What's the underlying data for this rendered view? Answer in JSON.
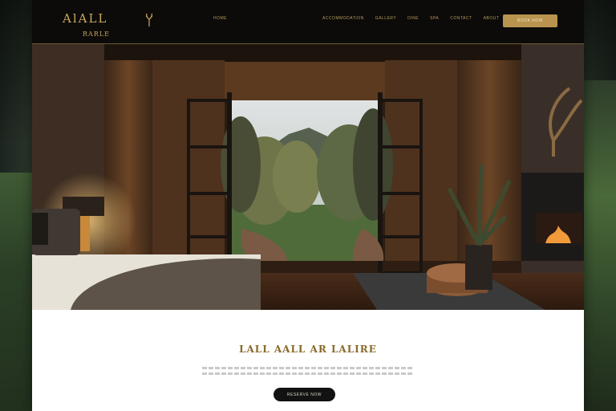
{
  "brand": {
    "logo_text": "AlALL",
    "logo_sub": "RARLE",
    "accent": "#c9a85c",
    "header_bg": "#0c0b09"
  },
  "nav": {
    "home": "HOME",
    "items": [
      "ACCOMMODATION",
      "GALLERY",
      "DINE",
      "SPA",
      "CONTACT",
      "ABOUT"
    ],
    "cta_label": "BOOK NOW"
  },
  "hero": {
    "image": "luxury-lodge-bedroom-with-open-doors-to-forest-and-mountains"
  },
  "content": {
    "headline": "LALL AALL AR LALIRE",
    "paragraph_lines": 2,
    "button_label": "RESERVE NOW",
    "button_color": "#121212"
  }
}
